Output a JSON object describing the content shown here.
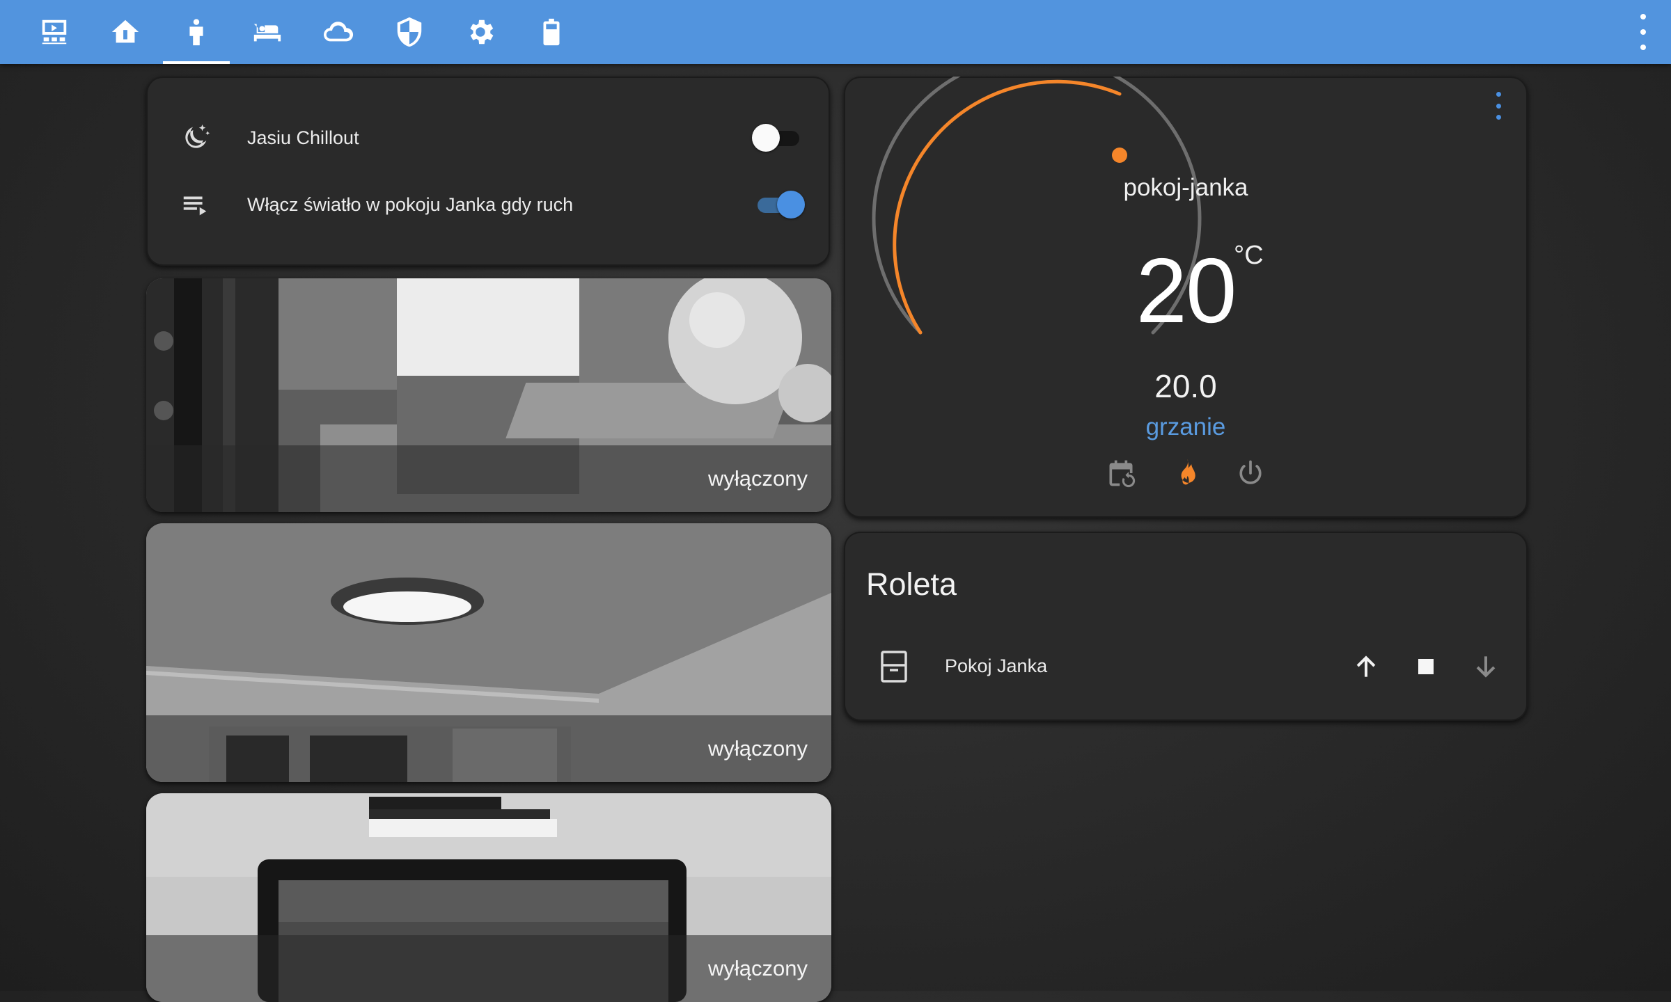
{
  "toolbar": {
    "tabs": [
      {
        "name": "tab-overview",
        "icon": "monitor-dashboard-icon"
      },
      {
        "name": "tab-home",
        "icon": "home-icon"
      },
      {
        "name": "tab-person",
        "icon": "human-icon",
        "active": true
      },
      {
        "name": "tab-bedroom",
        "icon": "bed-icon"
      },
      {
        "name": "tab-weather",
        "icon": "cloud-icon"
      },
      {
        "name": "tab-security",
        "icon": "shield-icon"
      },
      {
        "name": "tab-settings",
        "icon": "gear-icon"
      },
      {
        "name": "tab-battery",
        "icon": "battery-icon"
      }
    ],
    "accent_color": "#5294de"
  },
  "entities": {
    "rows": [
      {
        "label": "Jasiu Chillout",
        "icon": "weather-night-icon",
        "state": "off"
      },
      {
        "label": "Włącz światło w pokoju Janka gdy ruch",
        "icon": "playlist-play-icon",
        "state": "on"
      }
    ]
  },
  "cameras": [
    {
      "status": "wyłączony"
    },
    {
      "status": "wyłączony"
    },
    {
      "status": "wyłączony"
    }
  ],
  "thermostat": {
    "name": "pokoj-janka",
    "current_temp": "20",
    "unit": "°C",
    "target_temp": "20.0",
    "mode": "grzanie",
    "modes": [
      "calendar-sync-icon",
      "fire-icon",
      "power-icon"
    ],
    "active_mode": "fire-icon",
    "arc_color": "#f5862a",
    "mode_color": "#5a9be0"
  },
  "cover": {
    "title": "Roleta",
    "entity_label": "Pokoj Janka",
    "icon": "window-shutter-icon",
    "controls": [
      "arrow-up-icon",
      "stop-icon",
      "arrow-down-icon"
    ]
  }
}
